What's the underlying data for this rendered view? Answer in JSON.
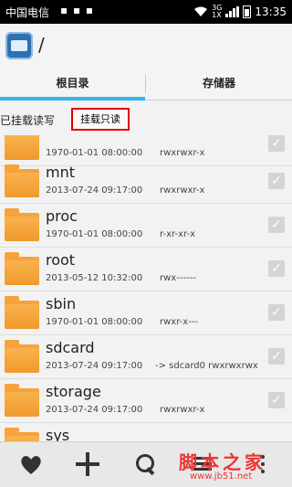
{
  "status_bar": {
    "carrier": "中国电信",
    "notification_dots": "▪ ▪ ▪",
    "network_top": "3G",
    "network_bottom": "1X",
    "time": "13:35"
  },
  "title_bar": {
    "path": "/"
  },
  "tabs": [
    {
      "label": "根目录",
      "active": true
    },
    {
      "label": "存储器",
      "active": false
    }
  ],
  "mount_bar": {
    "status": "已挂载读写",
    "button": "挂载只读"
  },
  "files": [
    {
      "name": "",
      "date": "1970-01-01 08:00:00",
      "perm": "rwxrwxr-x"
    },
    {
      "name": "mnt",
      "date": "2013-07-24 09:17:00",
      "perm": "rwxrwxr-x"
    },
    {
      "name": "proc",
      "date": "1970-01-01 08:00:00",
      "perm": "r-xr-xr-x"
    },
    {
      "name": "root",
      "date": "2013-05-12 10:32:00",
      "perm": "rwx------"
    },
    {
      "name": "sbin",
      "date": "1970-01-01 08:00:00",
      "perm": "rwxr-x---"
    },
    {
      "name": "sdcard",
      "date": "2013-07-24 09:17:00",
      "perm": "-> sdcard0  rwxrwxrwx"
    },
    {
      "name": "storage",
      "date": "2013-07-24 09:17:00",
      "perm": "rwxrwxr-x"
    },
    {
      "name": "sys",
      "date": "",
      "perm": ""
    }
  ],
  "bottom_bar": {
    "icons": [
      "heart-icon",
      "plus-icon",
      "search-icon",
      "menu-icon",
      "more-icon"
    ]
  },
  "watermark": {
    "text": "脚本之家",
    "url": "www.jb51.net"
  },
  "colors": {
    "accent": "#33b5e5",
    "folder": "#f7a23a",
    "highlight": "#e00000"
  }
}
